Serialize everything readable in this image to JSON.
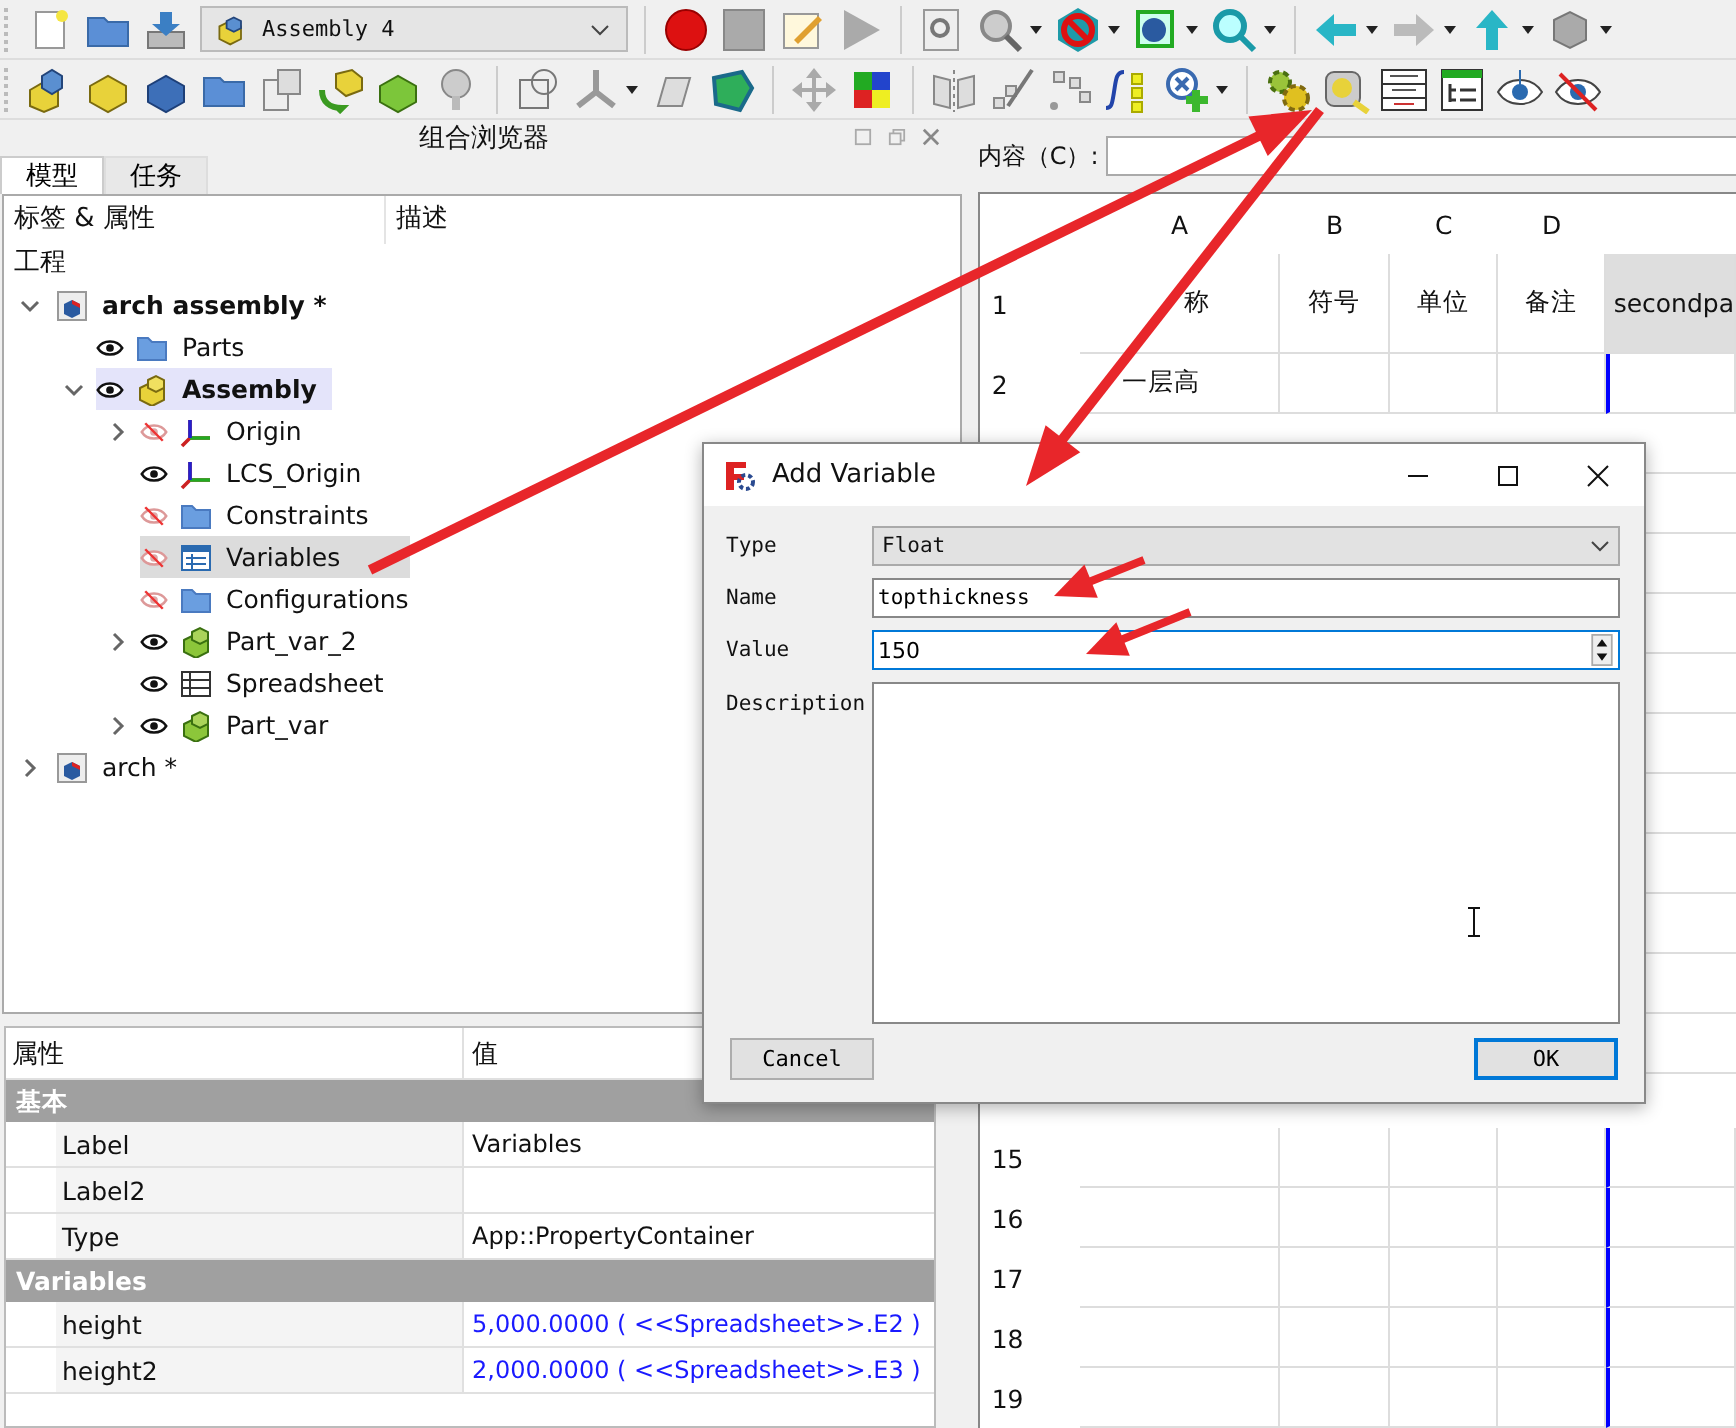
{
  "toolbar": {
    "document_dropdown": "Assembly 4"
  },
  "combo_view": {
    "title": "组合浏览器",
    "tabs": [
      {
        "label": "模型",
        "selected": true
      },
      {
        "label": "任务",
        "selected": false
      }
    ],
    "tree": {
      "columns": [
        "标签 & 属性",
        "描述"
      ],
      "root_label": "工程",
      "items": [
        {
          "label": "arch assembly *",
          "kind": "document",
          "bold": true,
          "active": false,
          "selected": false,
          "expanded": true,
          "children": [
            {
              "label": "Parts",
              "kind": "folder",
              "visible": true,
              "bold": false,
              "active": false,
              "selected": false
            },
            {
              "label": "Assembly",
              "kind": "assembly",
              "visible": true,
              "bold": true,
              "active": true,
              "selected": false,
              "expanded": true,
              "children": [
                {
                  "label": "Origin",
                  "kind": "axes",
                  "visible": false,
                  "bold": false,
                  "active": false,
                  "selected": false,
                  "expanded": false
                },
                {
                  "label": "LCS_Origin",
                  "kind": "axes",
                  "visible": true,
                  "bold": false,
                  "active": false,
                  "selected": false
                },
                {
                  "label": "Constraints",
                  "kind": "folder",
                  "visible": false,
                  "bold": false,
                  "active": false,
                  "selected": false
                },
                {
                  "label": "Variables",
                  "kind": "table",
                  "visible": false,
                  "bold": false,
                  "active": false,
                  "selected": true
                },
                {
                  "label": "Configurations",
                  "kind": "folder",
                  "visible": false,
                  "bold": false,
                  "active": false,
                  "selected": false
                },
                {
                  "label": "Part_var_2",
                  "kind": "part",
                  "visible": true,
                  "bold": false,
                  "active": false,
                  "selected": false,
                  "expanded": false
                },
                {
                  "label": "Spreadsheet",
                  "kind": "sheet",
                  "visible": true,
                  "bold": false,
                  "active": false,
                  "selected": false
                },
                {
                  "label": "Part_var",
                  "kind": "part",
                  "visible": true,
                  "bold": false,
                  "active": false,
                  "selected": false,
                  "expanded": false
                }
              ]
            }
          ]
        },
        {
          "label": "arch *",
          "kind": "document",
          "bold": false,
          "active": false,
          "selected": false,
          "expanded": false
        }
      ]
    }
  },
  "properties": {
    "columns": [
      "属性",
      "值"
    ],
    "groups": [
      {
        "name": "基本",
        "rows": [
          {
            "name": "Label",
            "value": "Variables",
            "kind": "plain"
          },
          {
            "name": "Label2"
          },
          {
            "name": "Type",
            "value": "App::PropertyContainer",
            "kind": "plain"
          }
        ]
      },
      {
        "name": "Variables",
        "rows": [
          {
            "name": "height",
            "value": "5,000.0000 ( <<Spreadsheet>>.E2 )",
            "kind": "expression"
          },
          {
            "name": "height2",
            "value": "2,000.0000 ( <<Spreadsheet>>.E3 )",
            "kind": "expression"
          }
        ]
      }
    ]
  },
  "spreadsheet": {
    "content_label": "内容（C）:",
    "columns": [
      "A",
      "B",
      "C",
      "D"
    ],
    "rows_top": [
      {
        "number": "1",
        "cells": [
          "称",
          "符号",
          "单位",
          "备注",
          "secondpa"
        ]
      },
      {
        "number": "2",
        "cells": [
          "一层高"
        ]
      }
    ],
    "rows_bottom": [
      {
        "number": "15"
      },
      {
        "number": "16"
      },
      {
        "number": "17"
      },
      {
        "number": "18"
      },
      {
        "number": "19"
      }
    ]
  },
  "dialog": {
    "title": "Add Variable",
    "fields": [
      {
        "label": "Type",
        "kind": "combo",
        "value": "Float"
      },
      {
        "label": "Name",
        "kind": "text",
        "value": "topthickness"
      },
      {
        "label": "Value",
        "kind": "spin",
        "value": "150"
      },
      {
        "label": "Description",
        "kind": "area"
      }
    ],
    "buttons": [
      {
        "label": "Cancel",
        "default": false
      },
      {
        "label": "OK",
        "default": true
      }
    ]
  }
}
